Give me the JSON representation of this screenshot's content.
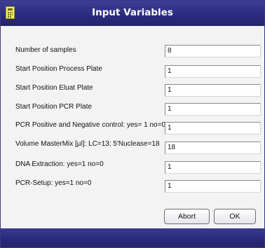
{
  "window": {
    "title": "Input Variables",
    "title_icon": "calculator-icon"
  },
  "fields": [
    {
      "label": "Number of samples",
      "value": "8"
    },
    {
      "label": "Start Position Process Plate",
      "value": "1"
    },
    {
      "label": "Start Position Eluat Plate",
      "value": "1"
    },
    {
      "label": "Start Position PCR Plate",
      "value": "1"
    },
    {
      "label": "PCR Positive and Negative control: yes= 1  no=0",
      "value": "1"
    },
    {
      "label": "Volume MasterMix [µl]: LC=13; 5'Nuclease=18",
      "value": "18"
    },
    {
      "label": "DNA Extraction: yes=1  no=0",
      "value": "1"
    },
    {
      "label": "PCR-Setup: yes=1  no=0",
      "value": "1"
    }
  ],
  "buttons": {
    "abort_label": "Abort",
    "ok_label": "OK"
  },
  "colors": {
    "titlebar": "#2d2d82",
    "title_text": "#ffffff",
    "dialog_background": "#f3f3f3"
  }
}
